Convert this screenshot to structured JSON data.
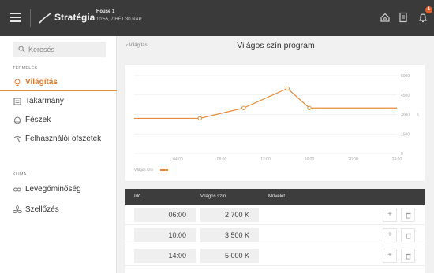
{
  "header": {
    "app_name": "Stratégia",
    "house_name": "House 1",
    "house_info": "10:55, 7 HÉT 30 NAP",
    "notification_count": "1"
  },
  "search": {
    "placeholder": "Keresés"
  },
  "sidebar": {
    "group1": "TERMELÉS",
    "items": [
      {
        "label": "Világítás",
        "icon": "bulb-icon",
        "active": true
      },
      {
        "label": "Takarmány",
        "icon": "feed-icon"
      },
      {
        "label": "Fészek",
        "icon": "nest-icon"
      },
      {
        "label": "Felhasználói ofszetek",
        "icon": "offset-icon"
      }
    ],
    "group2": "KLÍMA",
    "items2": [
      {
        "label": "Levegőminőség",
        "icon": "co2-icon"
      },
      {
        "label": "Szellőzés",
        "icon": "fan-icon"
      }
    ]
  },
  "page": {
    "back_label": "Világítás",
    "title": "Világos szín program"
  },
  "chart_data": {
    "type": "line",
    "x": [
      "00:00",
      "06:00",
      "10:00",
      "14:00",
      "16:00",
      "24:00"
    ],
    "series": [
      {
        "name": "Világos szín",
        "values": [
          2700,
          2700,
          3500,
          5000,
          3500,
          3500
        ]
      }
    ],
    "x_ticks": [
      "04:00",
      "08:00",
      "12:00",
      "16:00",
      "20:00",
      "24:00"
    ],
    "y_ticks": [
      "0",
      "1500",
      "3000",
      "4500",
      "6000"
    ],
    "y_unit": "K",
    "ylim": [
      0,
      6000
    ],
    "grid": true,
    "legend_position": "bottom-left",
    "color": "#e58d3c"
  },
  "table": {
    "columns": [
      "Idő",
      "Világos szín",
      "Művelet"
    ],
    "rows": [
      {
        "time": "06:00",
        "value": "2 700 K"
      },
      {
        "time": "10:00",
        "value": "3 500 K"
      },
      {
        "time": "14:00",
        "value": "5 000 K"
      }
    ],
    "add_symbol": "+"
  }
}
